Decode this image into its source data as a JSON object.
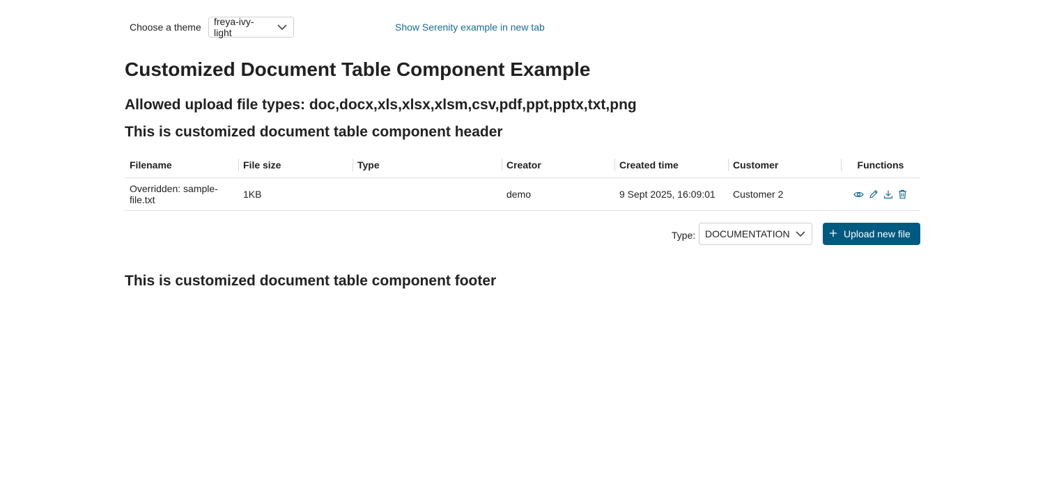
{
  "topbar": {
    "theme_label": "Choose a theme",
    "theme_value": "freya-ivy-light",
    "serenity_link": "Show Serenity example in new tab"
  },
  "headings": {
    "title": "Customized Document Table Component Example",
    "allowed_types": "Allowed upload file types: doc,docx,xls,xlsx,xlsm,csv,pdf,ppt,pptx,txt,png",
    "component_header": "This is customized document table component header",
    "component_footer": "This is customized document table component footer"
  },
  "table": {
    "columns": [
      "Filename",
      "File size",
      "Type",
      "Creator",
      "Created time",
      "Customer",
      "Functions"
    ],
    "rows": [
      {
        "filename": "Overridden: sample-file.txt",
        "file_size": "1KB",
        "type": "",
        "creator": "demo",
        "created_time": "9 Sept 2025, 16:09:01",
        "customer": "Customer 2",
        "functions": [
          "eye-icon",
          "pencil-icon",
          "download-icon",
          "trash-icon"
        ]
      }
    ]
  },
  "upload": {
    "type_label": "Type:",
    "type_value": "DOCUMENTATION",
    "button_label": "Upload new file"
  },
  "colors": {
    "accent": "#005a80",
    "link": "#1a6d8c",
    "icon": "#1a6d8c"
  }
}
